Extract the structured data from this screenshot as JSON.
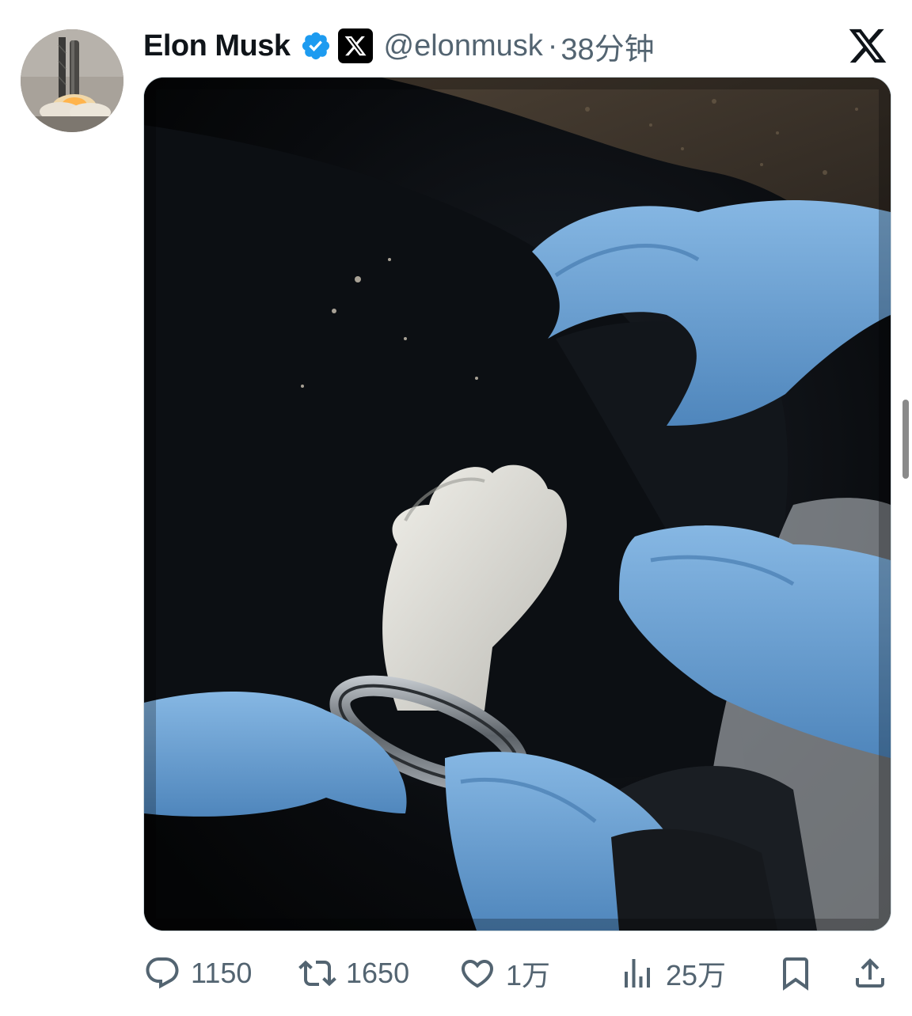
{
  "author": {
    "name": "Elon Musk",
    "handle": "@elonmusk",
    "separator": "·",
    "time": "38分钟"
  },
  "icons": {
    "verified": "verified-badge-icon",
    "affiliate": "x-affiliate-badge-icon",
    "platform": "x-logo-icon",
    "reply": "reply-icon",
    "retweet": "retweet-icon",
    "like": "heart-icon",
    "views": "views-chart-icon",
    "bookmark": "bookmark-icon",
    "share": "share-icon"
  },
  "colors": {
    "verified_blue": "#1d9bf0",
    "text_primary": "#0f1419",
    "text_secondary": "#536471"
  },
  "stats": {
    "replies": "1150",
    "retweets": "1650",
    "likes": "1万",
    "views": "25万"
  }
}
